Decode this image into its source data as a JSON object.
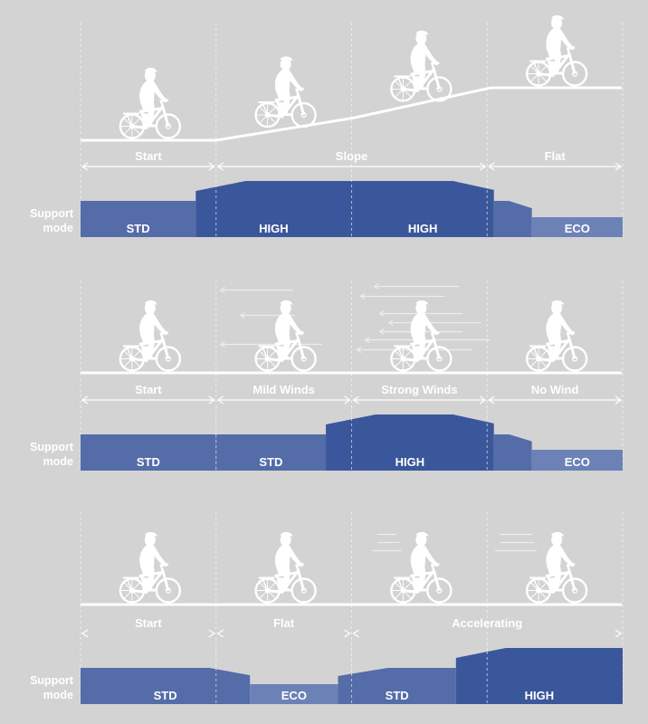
{
  "colors": {
    "background": "#d3d3d3",
    "foreground": "#ffffff",
    "HIGH": "#3b579b",
    "STD": "#546ca8",
    "ECO": "#6c82b7",
    "wind": "#ececec",
    "guide": "#ececec"
  },
  "support_label": [
    "Support",
    "mode"
  ],
  "mode_scale": {
    "ECO": 1,
    "STD": 2,
    "HIGH": 3
  },
  "panels": [
    {
      "name": "slope-scenario",
      "terrain": "slope",
      "segments": [
        {
          "label": "Start",
          "span": [
            0,
            1
          ]
        },
        {
          "label": "Slope",
          "span": [
            1,
            3
          ]
        },
        {
          "label": "Flat",
          "span": [
            3,
            4
          ]
        }
      ],
      "cyclists": [
        {
          "column": 0.5,
          "wind": "none"
        },
        {
          "column": 1.5,
          "wind": "none"
        },
        {
          "column": 2.5,
          "wind": "none"
        },
        {
          "column": 3.5,
          "wind": "none"
        }
      ],
      "modes": [
        {
          "mode": "STD",
          "label": "STD",
          "from": 0,
          "to": 0.85
        },
        {
          "mode": "HIGH",
          "label": "HIGH",
          "from": 0.85,
          "to": 2
        },
        {
          "mode": "HIGH",
          "label": "HIGH",
          "from": 2,
          "to": 3.05
        },
        {
          "mode": "STD",
          "label": "",
          "from": 3.05,
          "to": 3.33
        },
        {
          "mode": "ECO",
          "label": "ECO",
          "from": 3.33,
          "to": 4
        }
      ]
    },
    {
      "name": "wind-scenario",
      "terrain": "flat",
      "segments": [
        {
          "label": "Start",
          "span": [
            0,
            1
          ]
        },
        {
          "label": "Mild Winds",
          "span": [
            1,
            2
          ]
        },
        {
          "label": "Strong Winds",
          "span": [
            2,
            3
          ]
        },
        {
          "label": "No Wind",
          "span": [
            3,
            4
          ]
        }
      ],
      "cyclists": [
        {
          "column": 0.5,
          "wind": "none"
        },
        {
          "column": 1.5,
          "wind": "mild"
        },
        {
          "column": 2.5,
          "wind": "strong"
        },
        {
          "column": 3.5,
          "wind": "none"
        }
      ],
      "modes": [
        {
          "mode": "STD",
          "label": "STD",
          "from": 0,
          "to": 1
        },
        {
          "mode": "STD",
          "label": "STD",
          "from": 1,
          "to": 1.81
        },
        {
          "mode": "HIGH",
          "label": "HIGH",
          "from": 1.81,
          "to": 3.05
        },
        {
          "mode": "STD",
          "label": "",
          "from": 3.05,
          "to": 3.33
        },
        {
          "mode": "ECO",
          "label": "ECO",
          "from": 3.33,
          "to": 4
        }
      ]
    },
    {
      "name": "acceleration-scenario",
      "terrain": "flat",
      "segments": [
        {
          "label": "Start",
          "span": [
            0,
            1
          ]
        },
        {
          "label": "Flat",
          "span": [
            1,
            2
          ]
        },
        {
          "label": "Accelerating",
          "span": [
            2,
            4
          ]
        }
      ],
      "cyclists": [
        {
          "column": 0.5,
          "wind": "none"
        },
        {
          "column": 1.5,
          "wind": "none"
        },
        {
          "column": 2.5,
          "wind": "speed"
        },
        {
          "column": 3.5,
          "wind": "speed"
        }
      ],
      "modes": [
        {
          "mode": "STD",
          "label": "STD",
          "from": 0,
          "to": 1.25
        },
        {
          "mode": "ECO",
          "label": "ECO",
          "from": 1.25,
          "to": 1.9
        },
        {
          "mode": "STD",
          "label": "STD",
          "from": 1.9,
          "to": 2.77
        },
        {
          "mode": "HIGH",
          "label": "HIGH",
          "from": 2.77,
          "to": 4
        }
      ]
    }
  ]
}
